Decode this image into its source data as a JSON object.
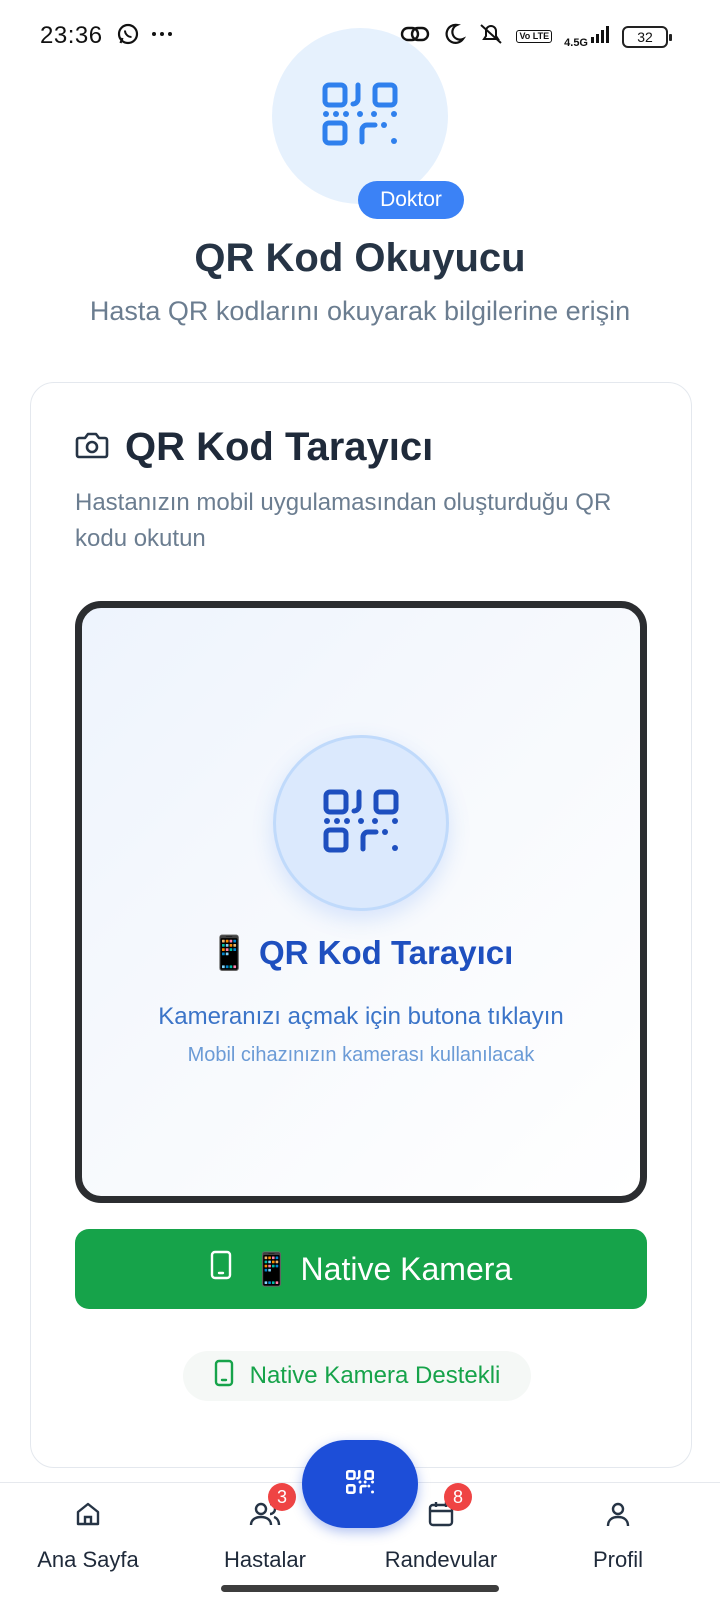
{
  "status_bar": {
    "time": "23:36",
    "network": "4.5G",
    "volte": "Vo LTE",
    "battery": "32"
  },
  "header": {
    "role_badge": "Doktor",
    "title": "QR Kod Okuyucu",
    "subtitle": "Hasta QR kodlarını okuyarak bilgilerine erişin"
  },
  "card": {
    "title": "QR Kod Tarayıcı",
    "description": "Hastanızın mobil uygulamasından oluşturduğu QR kodu okutun",
    "scanner": {
      "title": "📱 QR Kod Tarayıcı",
      "line1": "Kameranızı açmak için butona tıklayın",
      "line2": "Mobil cihazınızın kamerası kullanılacak"
    },
    "native_button_label": "📱 Native Kamera",
    "support_label": "Native Kamera Destekli"
  },
  "bottom_nav": {
    "items": [
      {
        "label": "Ana Sayfa",
        "icon": "home-icon"
      },
      {
        "label": "Hastalar",
        "icon": "users-icon",
        "badge": "3"
      },
      {
        "label": "Randevular",
        "icon": "calendar-icon",
        "badge": "8"
      },
      {
        "label": "Profil",
        "icon": "user-icon"
      }
    ],
    "fab_icon": "qr-code-icon"
  },
  "colors": {
    "primary": "#3b82f6",
    "fab": "#1d4ed8",
    "success": "#16a34a",
    "badge": "#ef4444",
    "title": "#263445",
    "muted": "#6b7d90"
  }
}
